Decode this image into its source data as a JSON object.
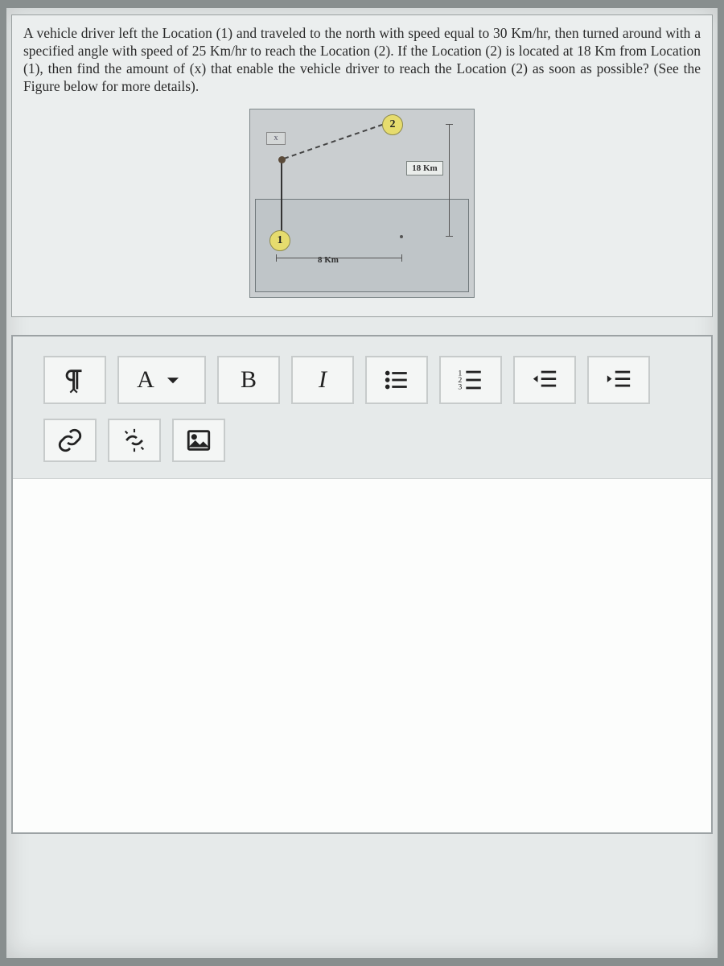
{
  "question": {
    "text": "A vehicle driver left the Location (1) and traveled to the north with speed equal to 30 Km/hr, then turned around with a specified angle with speed of 25 Km/hr to reach the Location (2). If the Location (2) is located at 18 Km from Location (1), then find the amount of (x) that enable the vehicle driver to reach the Location (2) as soon as possible? (See the Figure below for more details)."
  },
  "figure": {
    "node1_label": "1",
    "node2_label": "2",
    "x_label": "x",
    "dim_right": "18 Km",
    "dim_bottom": "8 Km"
  },
  "toolbar": {
    "paragraph_label": "¶",
    "font_label": "A",
    "bold_label": "B",
    "italic_label": "I"
  }
}
